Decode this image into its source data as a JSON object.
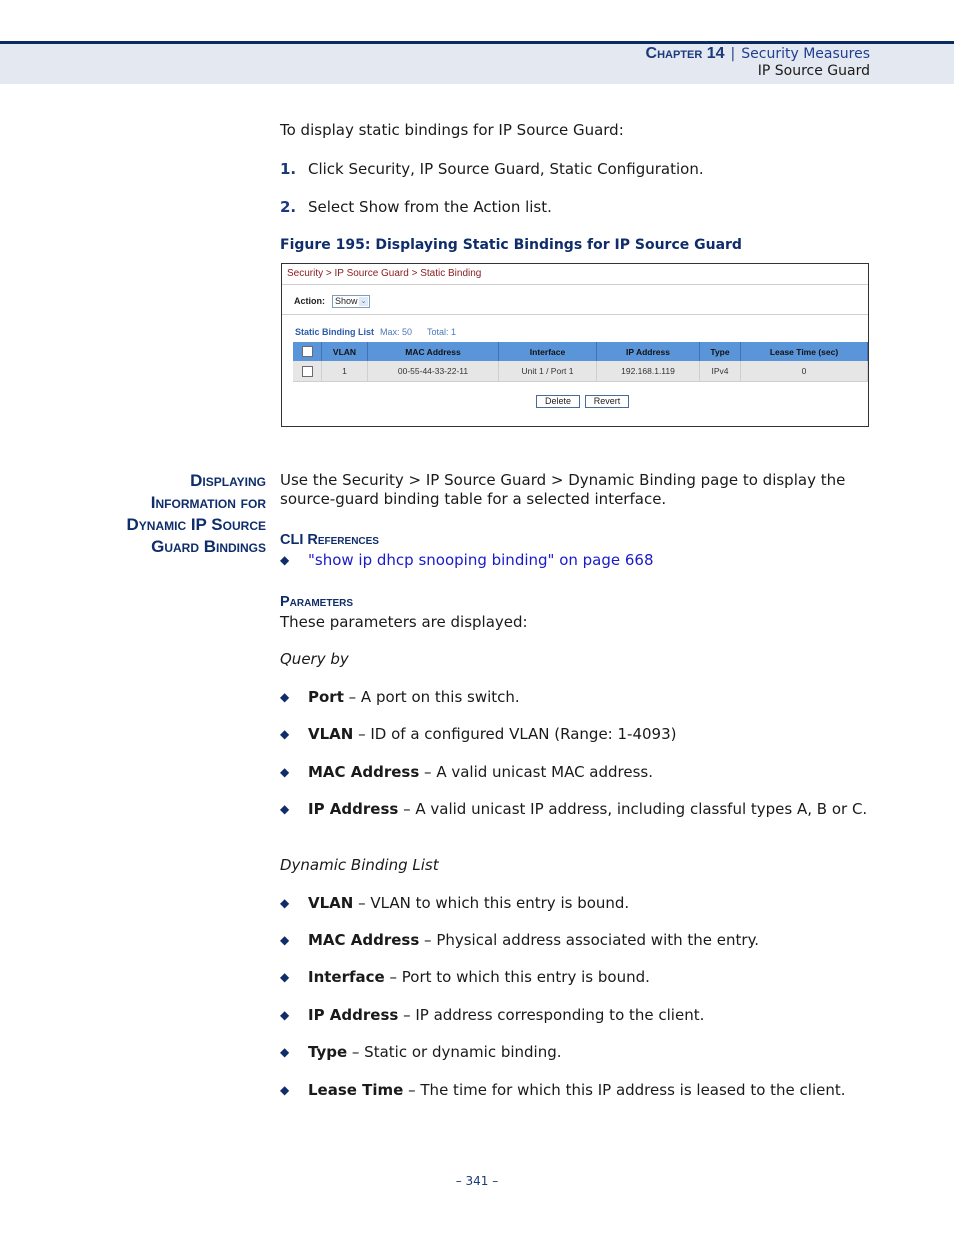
{
  "header": {
    "chapter_label": "Chapter 14",
    "separator": "|",
    "section_title": "Security Measures",
    "subsection_title": "IP Source Guard"
  },
  "intro": {
    "text": "To display static bindings for IP Source Guard:",
    "steps": [
      {
        "num": "1.",
        "text": "Click Security, IP Source Guard, Static Configuration."
      },
      {
        "num": "2.",
        "text": "Select Show from the Action list."
      }
    ]
  },
  "figure": {
    "caption": "Figure 195:  Displaying Static Bindings for IP Source Guard",
    "breadcrumb": "Security > IP Source Guard > Static Binding",
    "action_label": "Action:",
    "action_value": "Show",
    "list_title": "Static Binding List",
    "max_label": "Max: 50",
    "total_label": "Total: 1",
    "columns": [
      "VLAN",
      "MAC Address",
      "Interface",
      "IP Address",
      "Type",
      "Lease Time (sec)"
    ],
    "rows": [
      [
        "1",
        "00-55-44-33-22-11",
        "Unit 1 / Port 1",
        "192.168.1.119",
        "IPv4",
        "0"
      ]
    ],
    "buttons": {
      "delete": "Delete",
      "revert": "Revert"
    }
  },
  "section": {
    "heading_lines": [
      "Displaying",
      "Information for",
      "Dynamic IP Source",
      "Guard Bindings"
    ],
    "intro": "Use the Security > IP Source Guard > Dynamic Binding page to display the source-guard binding table for a selected interface.",
    "cli_heading": "CLI References",
    "cli_link": "\"show ip dhcp snooping binding\" on page 668",
    "params_heading": "Parameters",
    "params_intro": "These parameters are displayed:",
    "query_by_label": "Query by",
    "query_by": [
      {
        "term": "Port",
        "desc": " – A port on this switch."
      },
      {
        "term": "VLAN",
        "desc": " – ID of a configured VLAN (Range: 1-4093)"
      },
      {
        "term": "MAC Address",
        "desc": " – A valid unicast MAC address."
      },
      {
        "term": "IP Address",
        "desc": " – A valid unicast IP address, including classful types A, B or C."
      }
    ],
    "dynamic_list_label": "Dynamic Binding List",
    "dynamic_list": [
      {
        "term": "VLAN",
        "desc": " – VLAN to which this entry is bound."
      },
      {
        "term": "MAC Address",
        "desc": " – Physical address associated with the entry."
      },
      {
        "term": "Interface",
        "desc": " – Port to which this entry is bound."
      },
      {
        "term": "IP Address",
        "desc": " – IP address corresponding to the client."
      },
      {
        "term": "Type",
        "desc": " – Static or dynamic binding."
      },
      {
        "term": "Lease Time",
        "desc": " – The time for which this IP address is leased to the client."
      }
    ]
  },
  "footer": {
    "page_number": "–  341  –"
  },
  "icons": {
    "bullet": "◆",
    "dropdown": "⌄"
  }
}
